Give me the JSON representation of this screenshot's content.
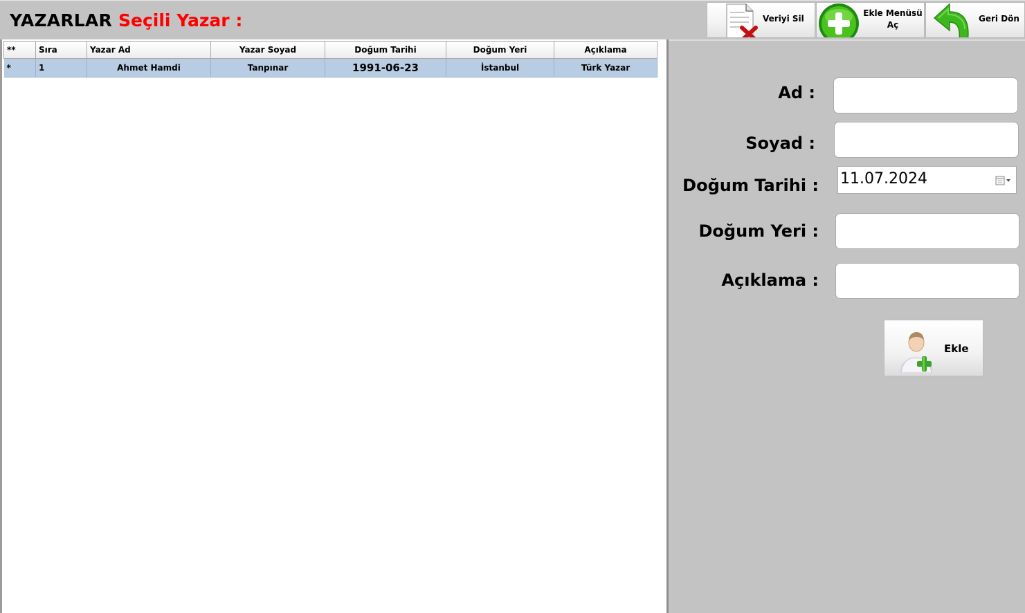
{
  "header": {
    "title": "YAZARLAR",
    "selected_label": "Seçili Yazar :"
  },
  "toolbar": {
    "delete_label": "Veriyi Sil",
    "delete_icon": "delete-document-icon",
    "add_menu_label_line1": "Ekle Menüsü",
    "add_menu_label_line2": "Aç",
    "add_menu_icon": "green-plus-icon",
    "back_label": "Geri Dön",
    "back_icon": "green-back-arrow-icon"
  },
  "grid": {
    "columns": [
      "**",
      "Sıra",
      "Yazar Ad",
      "Yazar Soyad",
      "Doğum Tarihi",
      "Doğum Yeri",
      "Açıklama"
    ],
    "rows": [
      [
        "*",
        "1",
        "Ahmet Hamdi",
        "Tanpınar",
        "1991-06-23",
        "İstanbul",
        "Türk Yazar"
      ]
    ],
    "selected_row_color": "#b8cce4"
  },
  "form": {
    "ad_label": "Ad :",
    "soyad_label": "Soyad :",
    "dogum_tarihi_label": "Doğum Tarihi  :",
    "dogum_tarihi_value": "11.07.2024",
    "dogum_yeri_label": "Doğum Yeri  :",
    "aciklama_label": "Açıklama  :",
    "add_button_label": "Ekle",
    "add_button_icon": "add-user-icon",
    "calendar_icon": "calendar-dropdown-icon"
  },
  "colors": {
    "accent_red": "#ff0000",
    "background_gray": "#c3c3c3"
  }
}
